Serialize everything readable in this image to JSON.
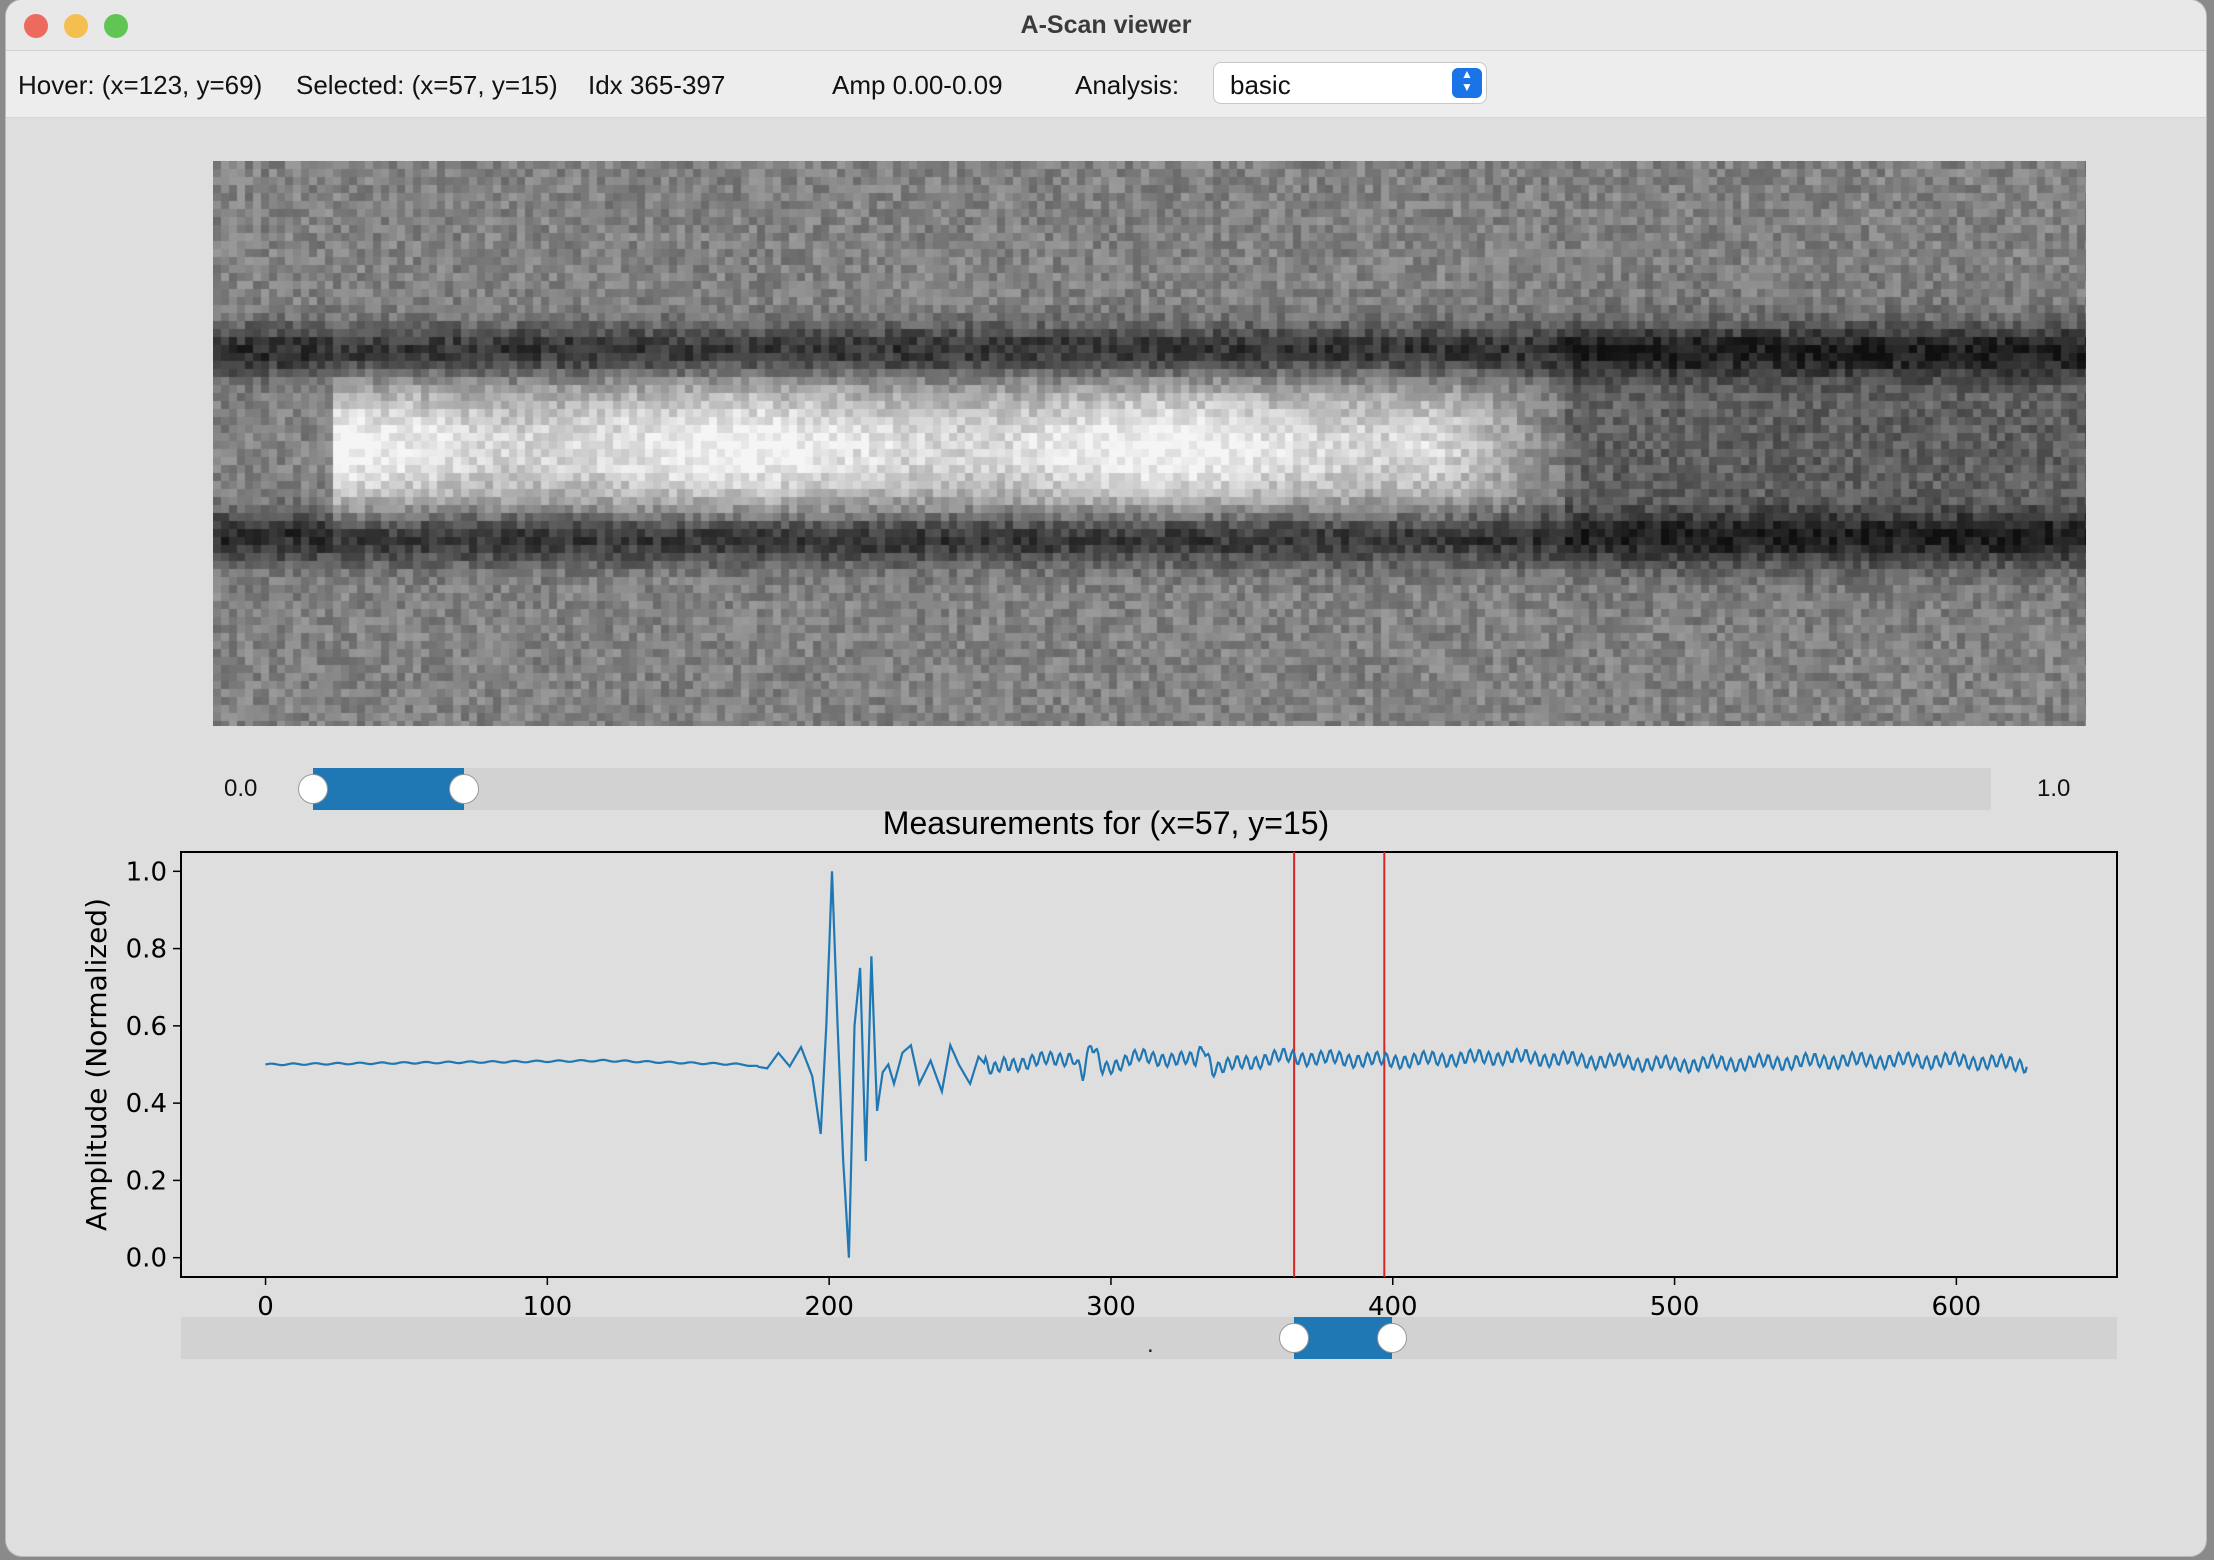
{
  "window": {
    "title": "A-Scan viewer"
  },
  "toolbar": {
    "hover": "Hover: (x=123, y=69)",
    "selected": "Selected: (x=57, y=15)",
    "idx": "Idx 365-397",
    "amp": "Amp 0.00-0.09",
    "analysis_label": "Analysis:",
    "analysis_value": "basic"
  },
  "amp_slider": {
    "min_label": "0.0",
    "max_label": "1.0",
    "min": 0,
    "max": 1,
    "low": 0.0,
    "high": 0.09
  },
  "index_slider": {
    "min": -30,
    "max": 657,
    "low": 365,
    "high": 397,
    "marker": "."
  },
  "colors": {
    "accent": "#1f77b4",
    "cursor": "#d62728"
  },
  "chart_data": {
    "type": "line",
    "title": "Measurements for (x=57, y=15)",
    "xlabel": "",
    "ylabel": "Amplitude (Normalized)",
    "xlim": [
      -30,
      657
    ],
    "ylim": [
      -0.05,
      1.05
    ],
    "xticks": [
      0,
      100,
      200,
      300,
      400,
      500,
      600
    ],
    "yticks": [
      0.0,
      0.2,
      0.4,
      0.6,
      0.8,
      1.0
    ],
    "vlines": [
      365,
      397
    ],
    "series": [
      {
        "x_start": 0,
        "x_end": 625,
        "baseline": 0.5,
        "points": [
          [
            0,
            0.5
          ],
          [
            60,
            0.505
          ],
          [
            120,
            0.51
          ],
          [
            170,
            0.5
          ],
          [
            178,
            0.49
          ],
          [
            182,
            0.53
          ],
          [
            186,
            0.495
          ],
          [
            190,
            0.545
          ],
          [
            194,
            0.47
          ],
          [
            197,
            0.32
          ],
          [
            199,
            0.6
          ],
          [
            201,
            1.0
          ],
          [
            203,
            0.6
          ],
          [
            205,
            0.25
          ],
          [
            207,
            0.0
          ],
          [
            209,
            0.6
          ],
          [
            211,
            0.75
          ],
          [
            213,
            0.25
          ],
          [
            215,
            0.78
          ],
          [
            217,
            0.38
          ],
          [
            219,
            0.48
          ],
          [
            221,
            0.5
          ],
          [
            223,
            0.45
          ],
          [
            226,
            0.53
          ],
          [
            229,
            0.55
          ],
          [
            232,
            0.45
          ],
          [
            236,
            0.51
          ],
          [
            240,
            0.43
          ],
          [
            243,
            0.55
          ],
          [
            246,
            0.5
          ],
          [
            250,
            0.45
          ],
          [
            253,
            0.52
          ],
          [
            258,
            0.48
          ],
          [
            262,
            0.5
          ],
          [
            287,
            0.52
          ],
          [
            290,
            0.47
          ],
          [
            293,
            0.55
          ],
          [
            297,
            0.49
          ],
          [
            310,
            0.52
          ],
          [
            330,
            0.51
          ],
          [
            333,
            0.55
          ],
          [
            336,
            0.49
          ],
          [
            360,
            0.52
          ],
          [
            400,
            0.51
          ],
          [
            440,
            0.52
          ],
          [
            500,
            0.5
          ],
          [
            560,
            0.51
          ],
          [
            600,
            0.51
          ],
          [
            625,
            0.5
          ]
        ],
        "oscillation": 0.016
      }
    ]
  }
}
